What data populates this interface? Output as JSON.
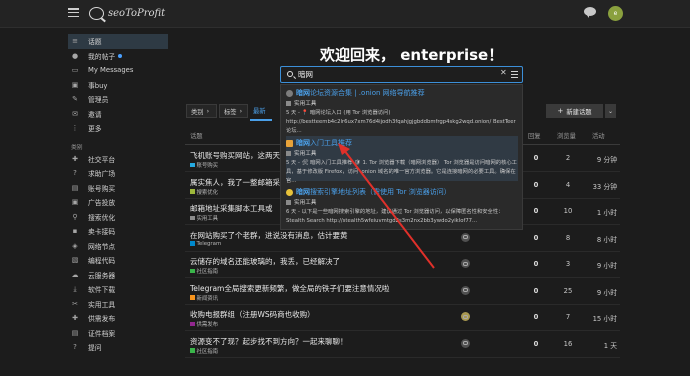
{
  "header": {
    "logo_text": "seoToProfit",
    "avatar_initial": "e"
  },
  "sidebar": {
    "items": [
      {
        "label": "话题",
        "icon": "layers-icon",
        "glyph": "≡",
        "active": true
      },
      {
        "label": "我的帖子",
        "icon": "user-icon",
        "glyph": "●",
        "dot": true
      },
      {
        "label": "My Messages",
        "icon": "inbox-icon",
        "glyph": "▭"
      },
      {
        "label": "事buy",
        "icon": "ticket-icon",
        "glyph": "▣"
      },
      {
        "label": "管理员",
        "icon": "wrench-icon",
        "glyph": "✎"
      },
      {
        "label": "邀请",
        "icon": "invite-icon",
        "glyph": "✉"
      },
      {
        "label": "更多",
        "icon": "more-icon",
        "glyph": "⋮"
      }
    ],
    "section_title": "类别",
    "categories": [
      {
        "label": "社交平台",
        "glyph": "✚"
      },
      {
        "label": "求助广场",
        "glyph": "?"
      },
      {
        "label": "账号购买",
        "glyph": "▤"
      },
      {
        "label": "广告投放",
        "glyph": "▣"
      },
      {
        "label": "搜索优化",
        "glyph": "⚲"
      },
      {
        "label": "卖卡接码",
        "glyph": "▪"
      },
      {
        "label": "网络节点",
        "glyph": "◈"
      },
      {
        "label": "编程代码",
        "glyph": "▧"
      },
      {
        "label": "云服务器",
        "glyph": "☁"
      },
      {
        "label": "软件下载",
        "glyph": "⤓"
      },
      {
        "label": "实用工具",
        "glyph": "✂"
      },
      {
        "label": "供需发布",
        "glyph": "✚"
      },
      {
        "label": "证件档案",
        "glyph": "▤"
      },
      {
        "label": "提问",
        "glyph": "?"
      }
    ]
  },
  "main": {
    "welcome": "欢迎回来， enterprise！",
    "search": {
      "value": "暗网"
    },
    "results": [
      {
        "title_hl": "暗网",
        "title_rest": "论坛资源合集 | .onion 网络导航推荐",
        "category": "实用工具",
        "blurb": "5 天 - 📍 暗网论坛入口 (用 Tor 浏览器访问) http://bestteemb4c2lr6ux7xm76d4ijodh3fqahjgjgbddbmfrgp4skg2wqd.onion/ BestTeer 论坛..."
      },
      {
        "title_hl": "暗网",
        "title_rest": "入门工具推荐",
        "category": "实用工具",
        "blurb": "5 天 - 🛠 暗网入门工具推荐 🛡 1. Tor 浏览器下载（暗网浏览器） Tor 浏览器是访问暗网的核心工具，基于修改版 Firefox，访问 .onion 域名的唯一官方浏览器。它是连接暗网的必要工具。确保在官..."
      },
      {
        "title_hl": "暗网",
        "title_rest": "搜索引擎地址列表（需使用 Tor 浏览器访问）",
        "category": "实用工具",
        "blurb": "6 天 - 以下是一些暗网搜索引擎的地址，建议通过 Tor 浏览器访问，以保障匿名性和安全性： Stealth Search http://stealth5wfeiuvmtgd2s3m2nx2bb3ywdo2yiklof77..."
      }
    ],
    "controls": {
      "category_dd": "类别",
      "tags_dd": "标签",
      "tab_latest": "最新",
      "new_topic": "新建话题"
    },
    "list_headers": {
      "topic": "话题",
      "replies": "回复",
      "views": "浏览量",
      "activity": "活动"
    },
    "topics": [
      {
        "title": "飞机账号购买网站，这两天",
        "category": "账号购买",
        "cat_color": "#25aae1",
        "replies": "0",
        "views": "2",
        "activity": "9 分钟"
      },
      {
        "title": "属实焦人，我了一整邮箱采",
        "category": "搜索优化",
        "cat_color": "#9eb83b",
        "replies": "0",
        "views": "4",
        "activity": "33 分钟"
      },
      {
        "title": "邮箱地址采集脚本工具或",
        "category": "实用工具",
        "cat_color": "#8c8c8c",
        "replies": "0",
        "views": "10",
        "activity": "1 小时"
      },
      {
        "title": "在网站购买了个老群，进说没有消息，估计要黄",
        "category": "Telegram",
        "cat_color": "#0088cc",
        "replies": "0",
        "views": "8",
        "activity": "8 小时"
      },
      {
        "title": "云储存的域名还能玻璃的，我丢，已经解决了",
        "category": "社区指南",
        "cat_color": "#3ab54a",
        "replies": "0",
        "views": "3",
        "activity": "9 小时"
      },
      {
        "title": "Telegram全局搜索更新频繁，做全局的铁子们要注意情况啦",
        "category": "新闻资讯",
        "cat_color": "#f7941d",
        "replies": "0",
        "views": "25",
        "activity": "9 小时"
      },
      {
        "title": "收购电报群组（注册WS码商也收购）",
        "category": "供需发布",
        "cat_color": "#92278f",
        "replies": "0",
        "views": "7",
        "activity": "15 小时"
      },
      {
        "title": "资源变不了现？起步找不到方向？一起来聊聊！",
        "category": "社区指南",
        "cat_color": "#3ab54a",
        "replies": "0",
        "views": "16",
        "activity": "1 天"
      }
    ]
  },
  "colors": {
    "accent": "#4a9fe8",
    "arrow": "#e0302a"
  }
}
